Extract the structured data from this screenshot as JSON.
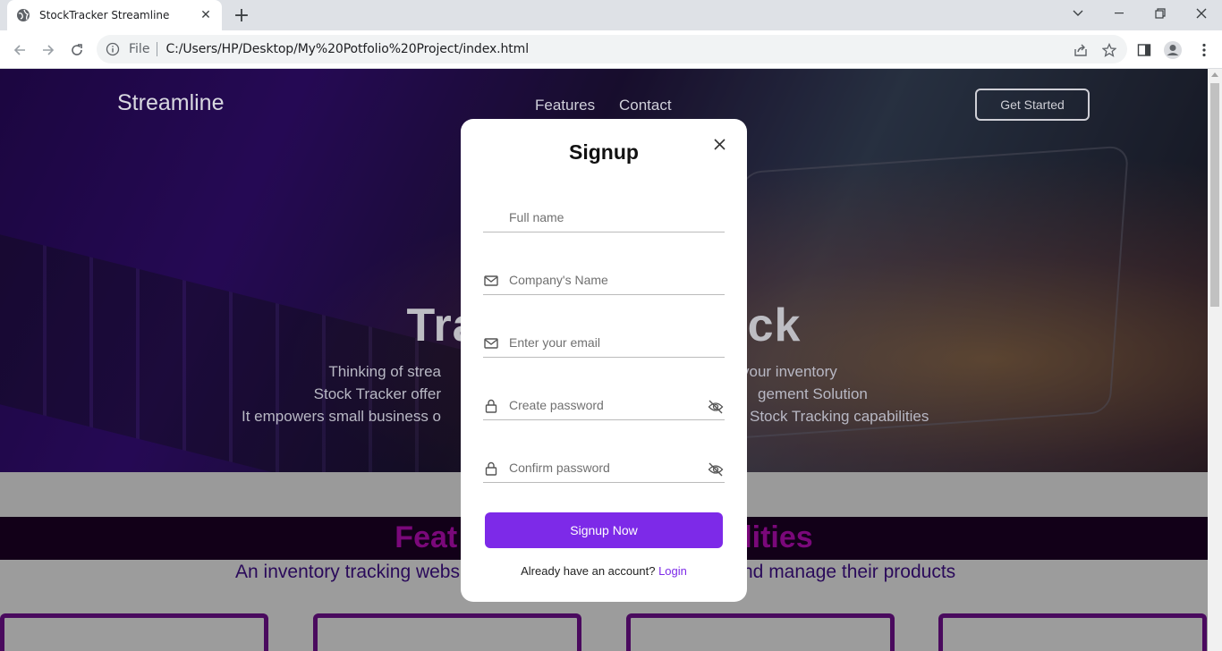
{
  "browser": {
    "tab_title": "StockTracker Streamline",
    "omnibox_scheme": "File",
    "url": "C:/Users/HP/Desktop/My%20Potfolio%20Project/index.html"
  },
  "page": {
    "brand": "Streamline",
    "nav": [
      "Features",
      "Contact"
    ],
    "cta": "Get Started",
    "hero_title_left": "Tra",
    "hero_title_right": "ck",
    "hero_lines": [
      {
        "left": "Thinking of strea",
        "right": "your inventory"
      },
      {
        "left": "Stock Tracker offer",
        "right": "gement Solution"
      },
      {
        "left": "It empowers small business o",
        "right": "Stock Tracking capabilities"
      }
    ],
    "features_left": "Feat",
    "features_right": "lities",
    "features_sub_left": "An inventory tracking webs",
    "features_sub_right": "nd manage their products"
  },
  "modal": {
    "title": "Signup",
    "fields": [
      {
        "placeholder": "Full name",
        "icon": "none"
      },
      {
        "placeholder": "Company's Name",
        "icon": "envelope-icon"
      },
      {
        "placeholder": "Enter your email",
        "icon": "envelope-icon"
      },
      {
        "placeholder": "Create password",
        "icon": "lock-icon",
        "toggle": "eye-slash-icon"
      },
      {
        "placeholder": "Confirm password",
        "icon": "lock-icon",
        "toggle": "eye-slash-icon"
      }
    ],
    "submit": "Signup Now",
    "already_text": "Already have an account?",
    "login_link": "Login"
  },
  "colors": {
    "accent": "#7d2ae8",
    "feature_title": "#7a087a"
  }
}
